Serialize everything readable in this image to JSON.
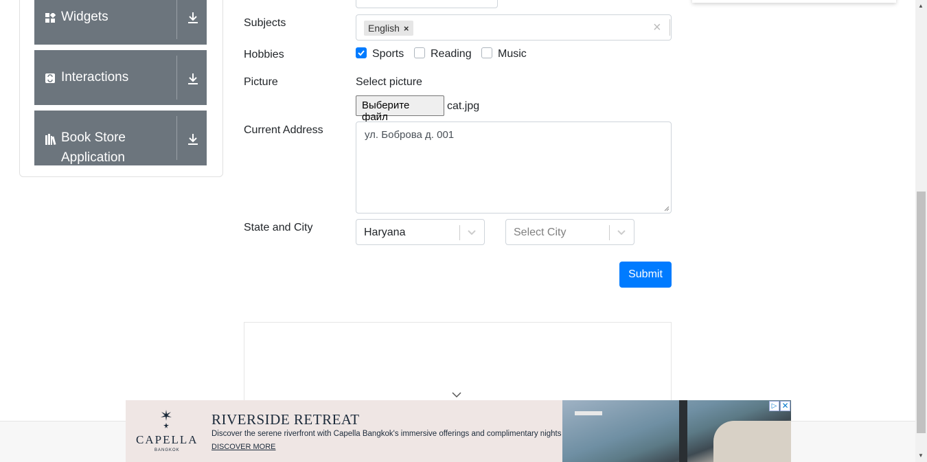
{
  "sidebar": {
    "groups": [
      {
        "label": "Widgets",
        "icon": "widgets-icon"
      },
      {
        "label": "Interactions",
        "icon": "interactions-icon"
      },
      {
        "label": "Book Store",
        "label_line2": "Application",
        "icon": "book-store-icon"
      }
    ]
  },
  "form": {
    "date_value_partial": "",
    "subjects": {
      "label": "Subjects",
      "chips": [
        "English"
      ]
    },
    "hobbies": {
      "label": "Hobbies",
      "options": [
        {
          "label": "Sports",
          "checked": true
        },
        {
          "label": "Reading",
          "checked": false
        },
        {
          "label": "Music",
          "checked": false
        }
      ]
    },
    "picture": {
      "label": "Picture",
      "select_text": "Select picture",
      "button_label": "Выберите файл",
      "file_name": "cat.jpg"
    },
    "address": {
      "label": "Current Address",
      "value": "ул. Боброва д. 001"
    },
    "state_city": {
      "label": "State and City",
      "state_value": "Haryana",
      "city_placeholder": "Select City"
    },
    "submit_label": "Submit"
  },
  "ad": {
    "brand": "CAPELLA",
    "brand_sub": "BANGKOK",
    "headline": "RIVERSIDE RETREAT",
    "body": "Discover the serene riverfront with Capella Bangkok's immersive offerings and complimentary nights",
    "cta": "DISCOVER MORE"
  },
  "colors": {
    "primary": "#007bff",
    "sidebar_group": "#6c757d",
    "ad_bg": "#efe6e4"
  }
}
